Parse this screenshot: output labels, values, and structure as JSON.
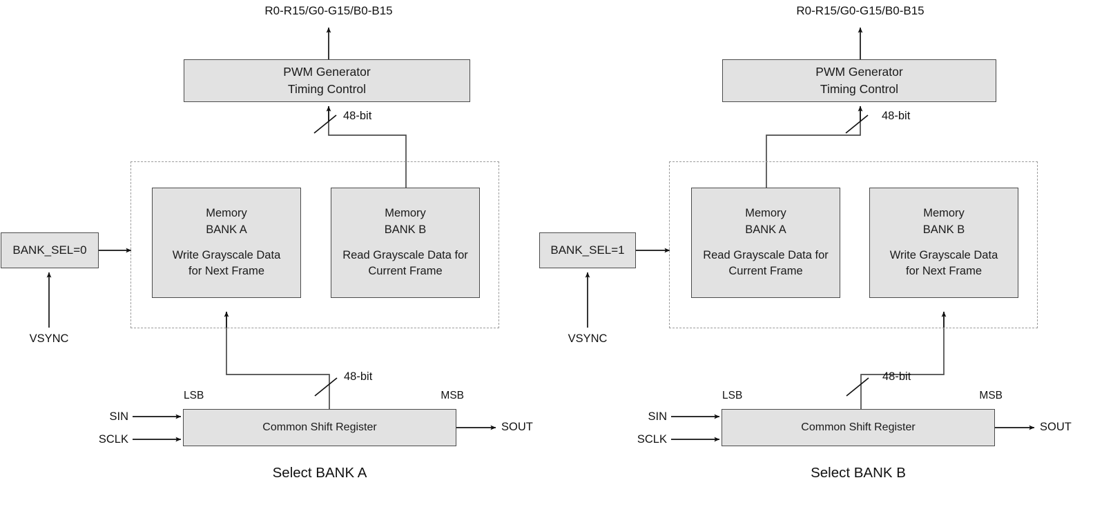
{
  "diagram": {
    "title": "Dual memory bank grayscale data flow",
    "colors": {
      "box_fill": "#e2e2e2",
      "box_border": "#4a4a4a",
      "wire": "#1a1a1a",
      "dashed_border": "#9a9a9a",
      "background": "#ffffff"
    }
  },
  "panels": [
    {
      "id": "select-bank-a",
      "caption": "Select BANK A",
      "output_label": "R0-R15/G0-G15/B0-B15",
      "pwm": {
        "line1": "PWM Generator",
        "line2": "Timing Control"
      },
      "bus_top_label": "48-bit",
      "bus_bottom_label": "48-bit",
      "bank_sel": {
        "label": "BANK_SEL=0"
      },
      "vsync_label": "VSYNC",
      "memories": [
        {
          "id": "memory-bank-a",
          "line1": "Memory",
          "line2": "BANK A",
          "line3": "Write Grayscale Data",
          "line4": "for Next Frame"
        },
        {
          "id": "memory-bank-b",
          "line1": "Memory",
          "line2": "BANK B",
          "line3": "Read Grayscale Data for",
          "line4": "Current Frame"
        }
      ],
      "shift_register": {
        "label": "Common Shift Register",
        "lsb": "LSB",
        "msb": "MSB",
        "sin": "SIN",
        "sclk": "SCLK",
        "sout": "SOUT"
      }
    },
    {
      "id": "select-bank-b",
      "caption": "Select BANK B",
      "output_label": "R0-R15/G0-G15/B0-B15",
      "pwm": {
        "line1": "PWM Generator",
        "line2": "Timing Control"
      },
      "bus_top_label": "48-bit",
      "bus_bottom_label": "48-bit",
      "bank_sel": {
        "label": "BANK_SEL=1"
      },
      "vsync_label": "VSYNC",
      "memories": [
        {
          "id": "memory-bank-a",
          "line1": "Memory",
          "line2": "BANK A",
          "line3": "Read Grayscale Data for",
          "line4": "Current Frame"
        },
        {
          "id": "memory-bank-b",
          "line1": "Memory",
          "line2": "BANK B",
          "line3": "Write Grayscale Data",
          "line4": "for Next Frame"
        }
      ],
      "shift_register": {
        "label": "Common Shift Register",
        "lsb": "LSB",
        "msb": "MSB",
        "sin": "SIN",
        "sclk": "SCLK",
        "sout": "SOUT"
      }
    }
  ]
}
